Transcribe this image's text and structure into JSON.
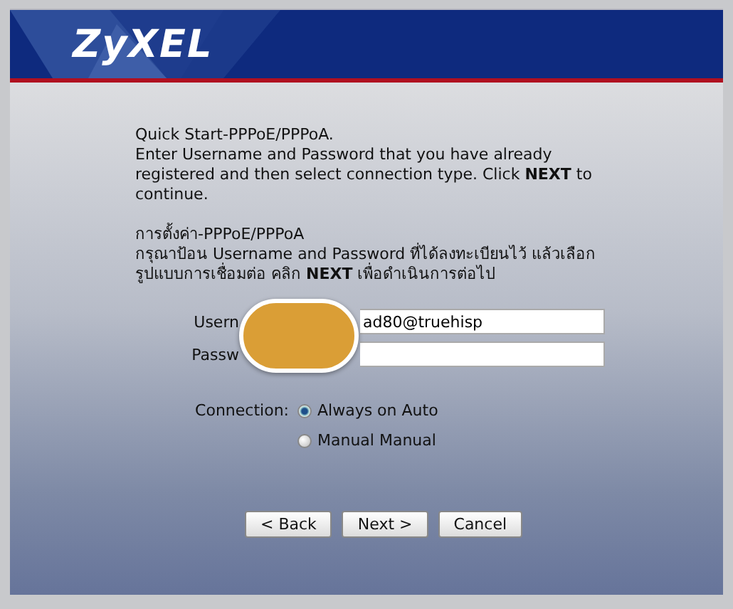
{
  "logo": "ZyXEL",
  "intro": {
    "title": "Quick Start-PPPoE/PPPoA.",
    "text": "Enter Username and Password that you have already registered and then select connection type. Click **NEXT** to continue."
  },
  "intro_thai": {
    "title": "การตั้งค่า-PPPoE/PPPoA",
    "text": "กรุณาป้อน Username and Password ที่ได้ลงทะเบียนไว้ แล้วเลือกรูปแบบการเชื่อมต่อ คลิก **NEXT** เพื่อดำเนินการต่อไป"
  },
  "fields": [
    {
      "label": "Usern",
      "value": "ad80@truehisp"
    },
    {
      "label": "Passw"
    }
  ],
  "connection": {
    "label": "Connection:",
    "options": [
      {
        "label": "Always on Auto",
        "selected": true
      },
      {
        "label": "Manual Manual",
        "selected": false
      }
    ]
  },
  "buttons": [
    "< Back",
    "Next >",
    "Cancel"
  ]
}
